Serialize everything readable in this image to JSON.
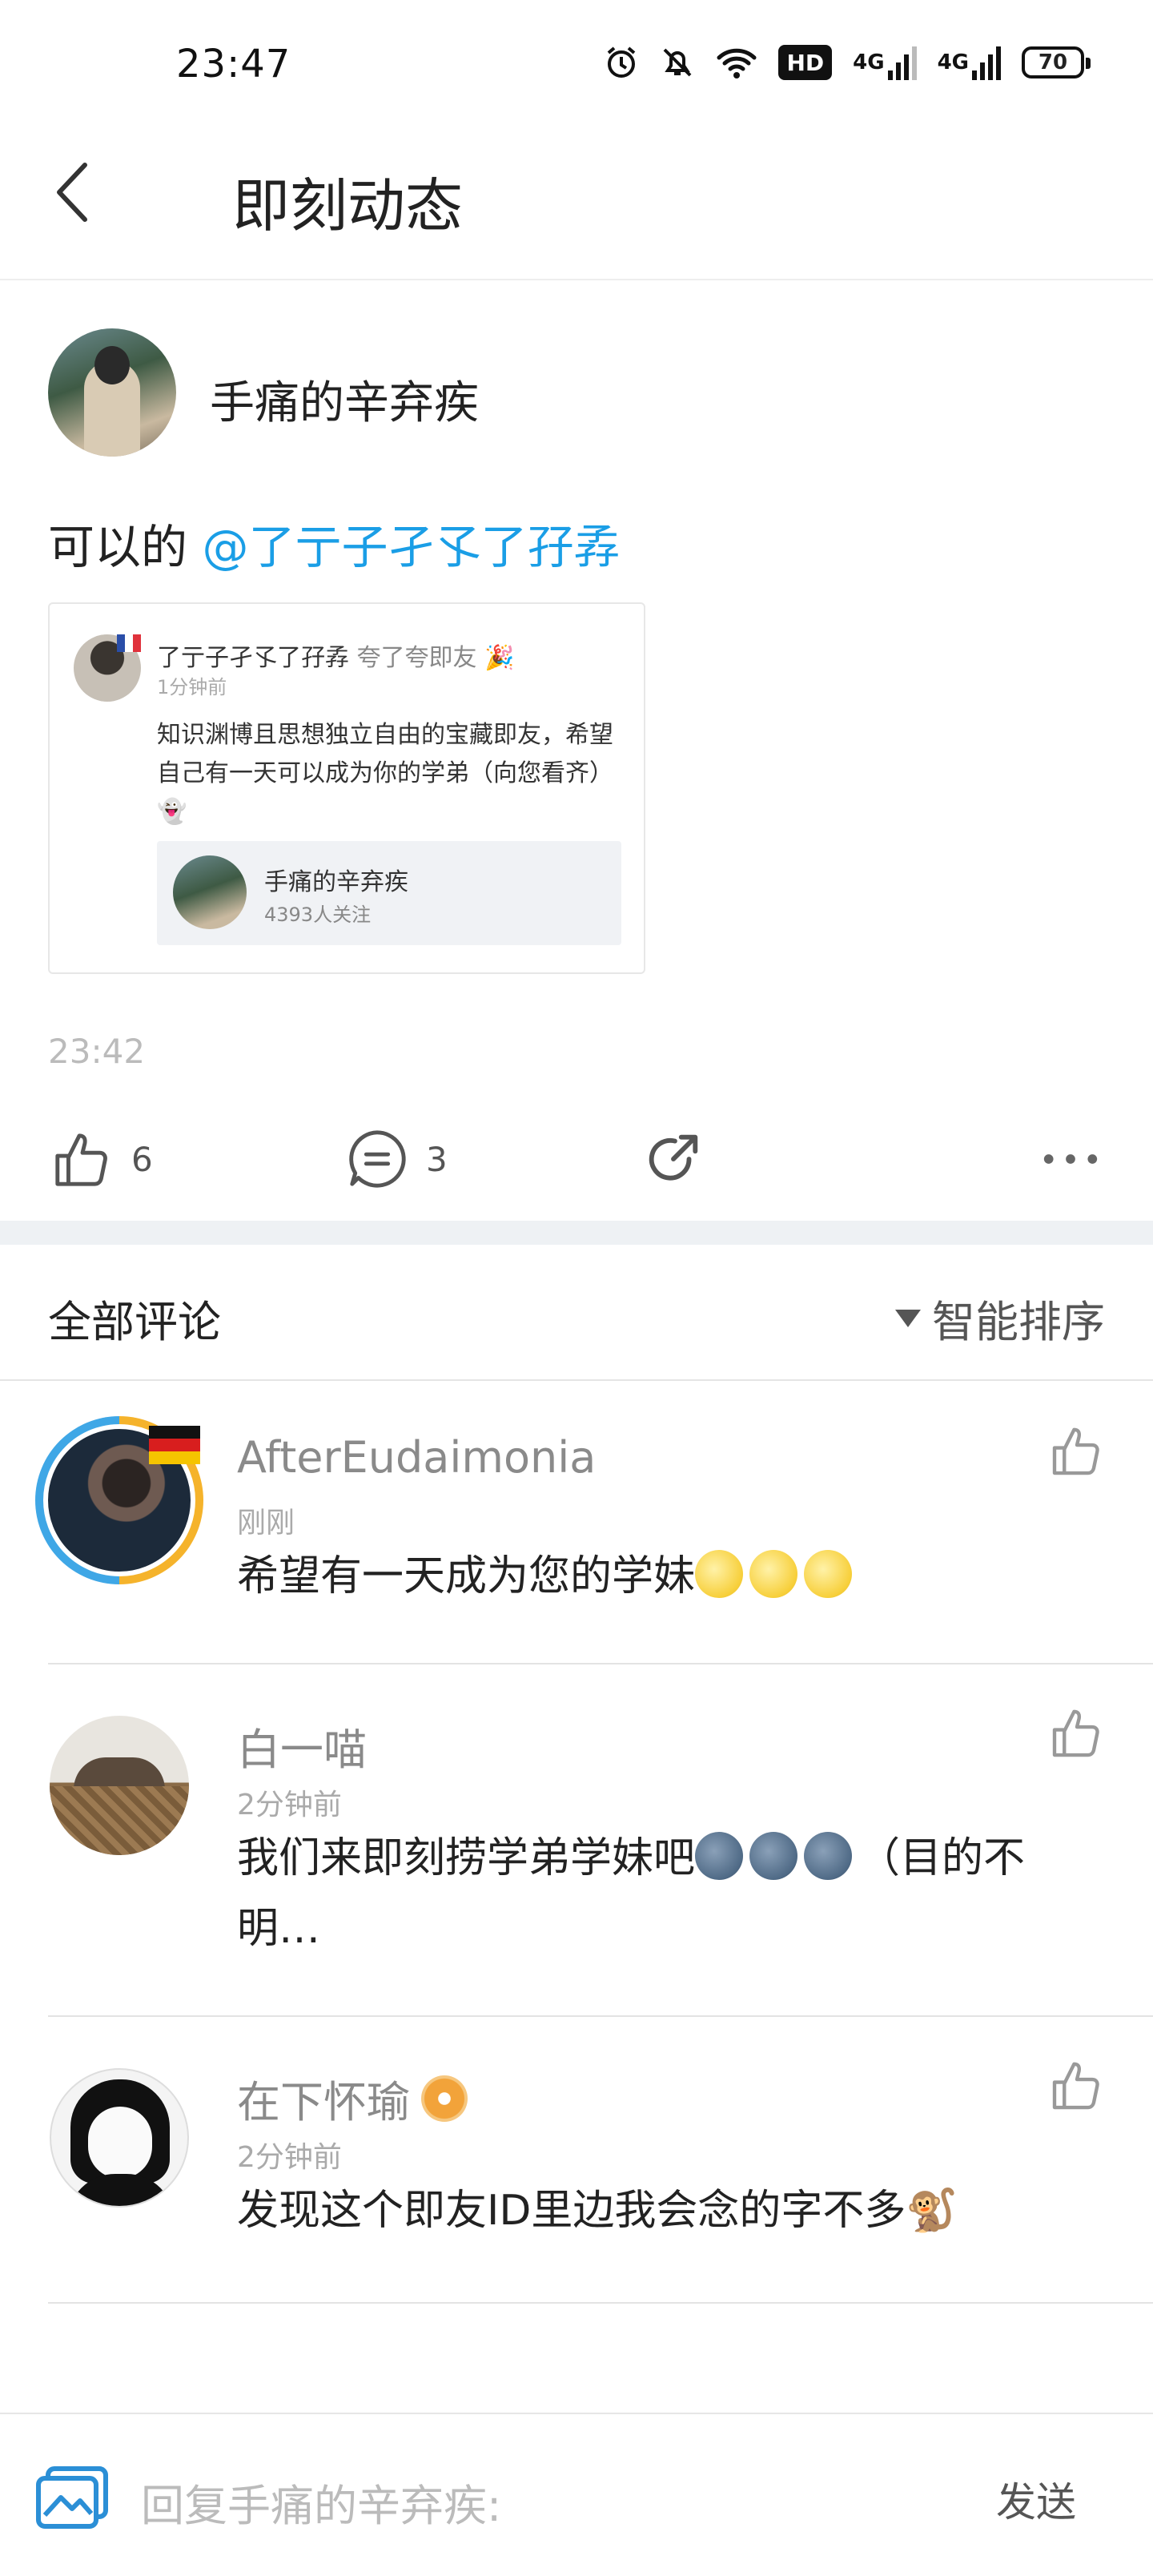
{
  "status_bar": {
    "time": "23:47",
    "hd_label": "HD",
    "net1": "4G",
    "net2": "4G",
    "battery": "70"
  },
  "header": {
    "title": "即刻动态"
  },
  "post": {
    "author": "手痛的辛弃疾",
    "text_prefix": "可以的 ",
    "mention": "@了亍子孑孓了孖孨",
    "quote": {
      "author": "了亍子孑孓了孖孨",
      "author_tag": "夸了夸即友 🎉",
      "time": "1分钟前",
      "text": "知识渊博且思想独立自由的宝藏即友，希望自己有一天可以成为你的学弟（向您看齐）👻",
      "embed_name": "手痛的辛弃疾",
      "embed_sub": "4393人关注"
    },
    "time": "23:42",
    "likes": "6",
    "comments": "3"
  },
  "comments_section": {
    "title": "全部评论",
    "sort_label": "智能排序",
    "items": [
      {
        "name": "AfterEudaimonia",
        "time": "刚刚",
        "text": "希望有一天成为您的学妹",
        "emoji": "sun"
      },
      {
        "name": "白一喵",
        "time": "2分钟前",
        "text_part1": "我们来即刻捞学弟学妹吧",
        "text_part2": "（目的不明…",
        "emoji": "moon"
      },
      {
        "name": "在下怀瑜",
        "time": "2分钟前",
        "text": "发现这个即友ID里边我会念的字不多🐒"
      }
    ]
  },
  "reply_bar": {
    "placeholder": "回复手痛的辛弃疾:",
    "send_label": "发送"
  }
}
